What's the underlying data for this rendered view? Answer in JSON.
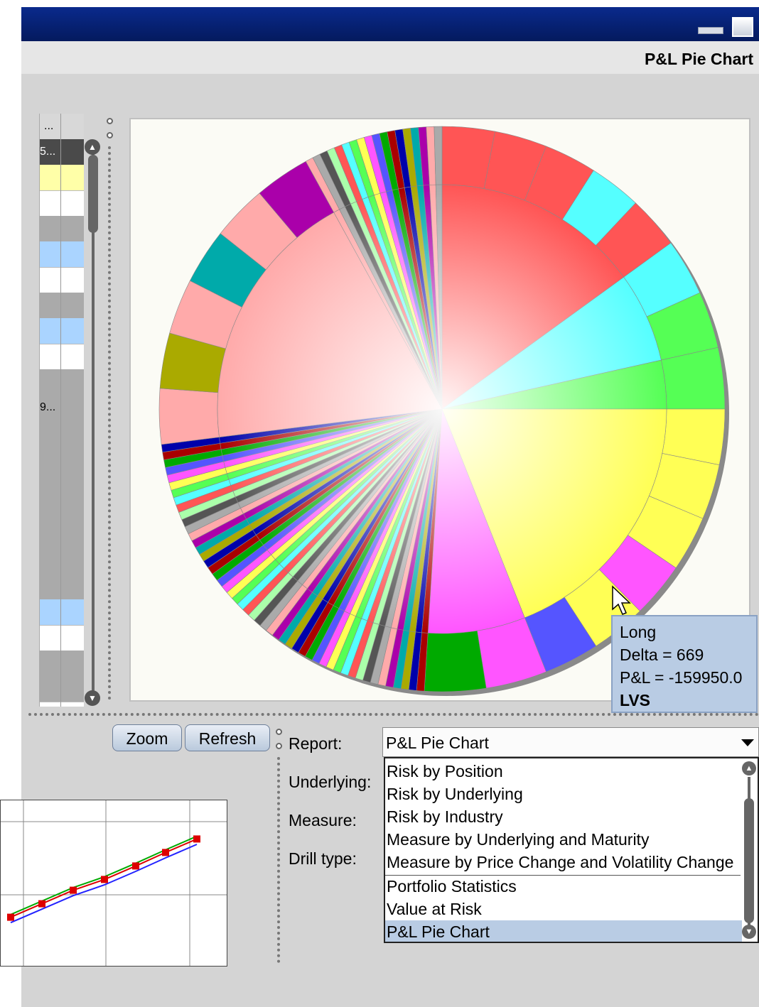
{
  "window": {
    "title": "P&L Pie Chart"
  },
  "left_table": {
    "cell_a": "...",
    "cell_b": "5...",
    "cell_c": "...",
    "cell_d": "9...",
    "cell_e": "..."
  },
  "pie": {
    "slices": [
      {
        "pct": 15.0,
        "color": "#ff5555"
      },
      {
        "pct": 6.5,
        "color": "#55ffff"
      },
      {
        "pct": 3.5,
        "color": "#55ff55"
      },
      {
        "pct": 19.0,
        "color": "#ffff55"
      },
      {
        "pct": 7.0,
        "color": "#ff55ff"
      },
      {
        "pct": 22.0,
        "color": "mix"
      },
      {
        "pct": 19.0,
        "color": "#ffaaaa"
      },
      {
        "pct": 8.0,
        "color": "mix"
      }
    ],
    "palette": [
      "#ff5555",
      "#55ffff",
      "#55ff55",
      "#ffff55",
      "#ff55ff",
      "#5555ff",
      "#00aa00",
      "#aa0000",
      "#0000aa",
      "#aaaa00",
      "#00aaaa",
      "#aa00aa",
      "#ffaaaa",
      "#aaaaaa",
      "#555555",
      "#aaffaa"
    ]
  },
  "tooltip": {
    "side": "Long",
    "delta": "Delta = 669",
    "pnl": "P&L = -159950.0",
    "symbol": "LVS"
  },
  "buttons": {
    "zoom": "Zoom",
    "refresh": "Refresh"
  },
  "form": {
    "report_label": "Report:",
    "underlying_label": "Underlying:",
    "measure_label": "Measure:",
    "drill_label": "Drill type:",
    "report_value": "P&L Pie Chart"
  },
  "dropdown": {
    "items": [
      "Risk by Position",
      "Risk by Underlying",
      "Risk by Industry",
      "Measure by Underlying and Maturity",
      "Measure by Price Change and Volatility Change",
      "Portfolio Statistics",
      "Value at Risk",
      "P&L Pie Chart"
    ],
    "selected_index": 7
  },
  "mini_chart": {
    "series": [
      {
        "color": "#00aa00",
        "values": [
          3.9,
          4.4,
          4.9,
          5.3,
          5.8,
          6.3,
          6.8
        ]
      },
      {
        "color": "#dd0000",
        "values": [
          3.8,
          4.3,
          4.8,
          5.2,
          5.7,
          6.2,
          6.7
        ]
      },
      {
        "color": "#2222ff",
        "values": [
          3.6,
          4.1,
          4.6,
          5.0,
          5.5,
          6.0,
          6.5
        ]
      }
    ]
  }
}
